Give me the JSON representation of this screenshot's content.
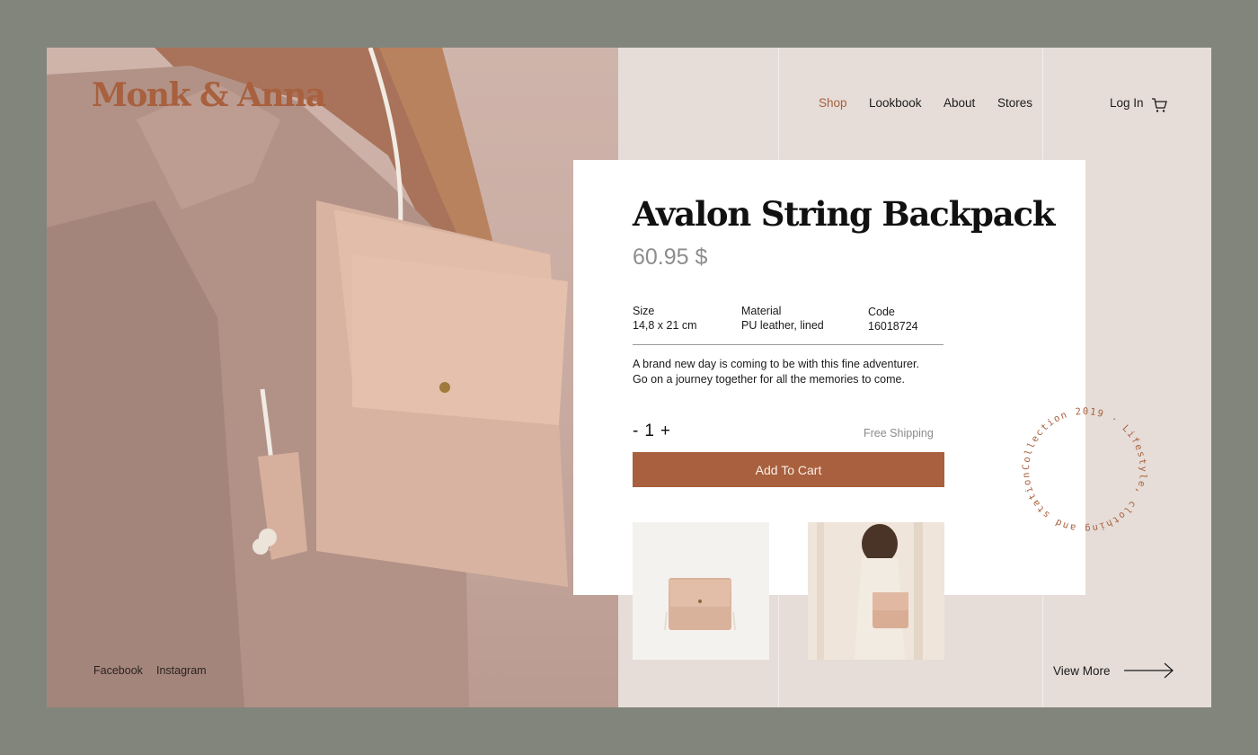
{
  "brand": {
    "logo": "Monk & Anna"
  },
  "nav": {
    "items": [
      "Shop",
      "Lookbook",
      "About",
      "Stores"
    ],
    "active": "Shop",
    "login": "Log In"
  },
  "social": {
    "facebook": "Facebook",
    "instagram": "Instagram"
  },
  "product": {
    "title": "Avalon String Backpack",
    "price": "60.95 $",
    "specs": [
      {
        "label": "Size",
        "value": "14,8 x 21 cm"
      },
      {
        "label": "Material",
        "value": "PU leather, lined"
      },
      {
        "label": "Code",
        "value": "16018724"
      }
    ],
    "description": [
      "A brand new day is coming to be with this fine adventurer.",
      "Go on a journey together for all the memories to come."
    ],
    "quantity": {
      "minus": "-",
      "value": "1",
      "plus": "+"
    },
    "shipping": "Free Shipping",
    "add_to_cart": "Add To Cart"
  },
  "badge": {
    "text": "Collection 2019 · Lifestyle, clothing and stationery ·"
  },
  "footer": {
    "view_more": "View More"
  },
  "colors": {
    "accent": "#a8603e",
    "background": "#e6ddd8",
    "page": "#82857c"
  }
}
